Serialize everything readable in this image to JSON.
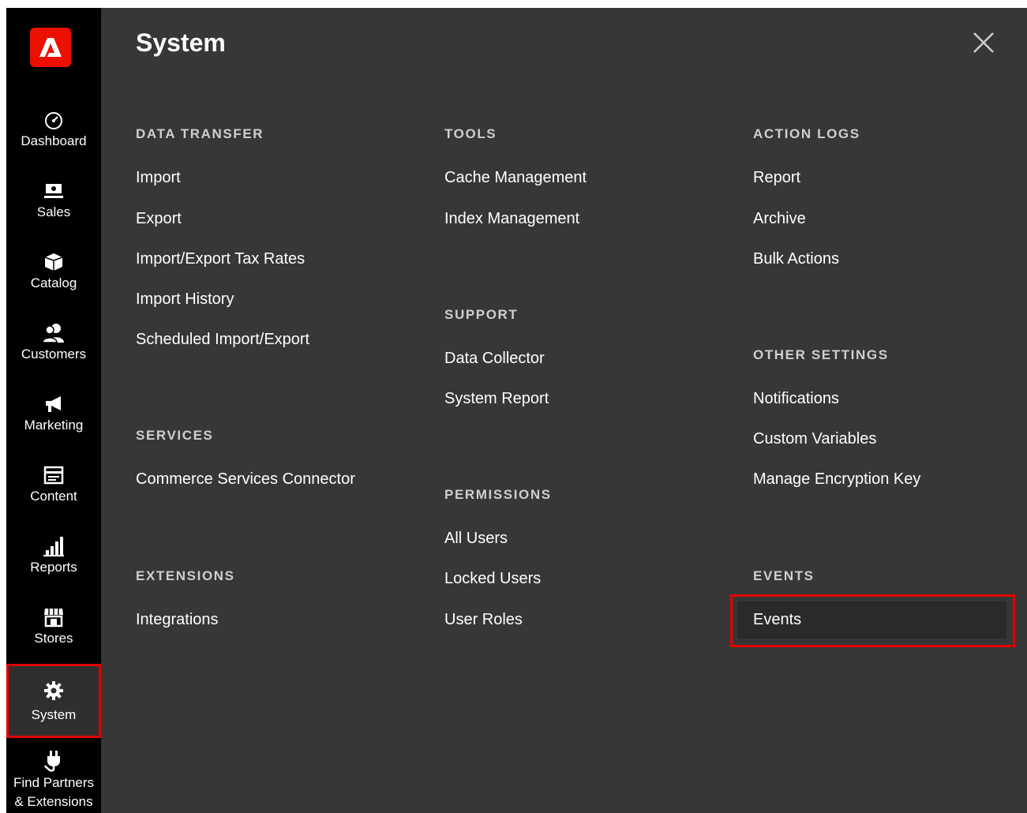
{
  "sidebar": {
    "logo": "adobe-logo",
    "items": [
      {
        "label": "Dashboard",
        "icon": "dashboard-icon"
      },
      {
        "label": "Sales",
        "icon": "sales-icon"
      },
      {
        "label": "Catalog",
        "icon": "catalog-icon"
      },
      {
        "label": "Customers",
        "icon": "customers-icon"
      },
      {
        "label": "Marketing",
        "icon": "marketing-icon"
      },
      {
        "label": "Content",
        "icon": "content-icon"
      },
      {
        "label": "Reports",
        "icon": "reports-icon"
      },
      {
        "label": "Stores",
        "icon": "stores-icon"
      },
      {
        "label": "System",
        "icon": "gear-icon"
      },
      {
        "label": "Find Partners",
        "label2": "& Extensions",
        "icon": "plug-icon"
      }
    ]
  },
  "panel": {
    "title": "System",
    "close_icon": "close-icon",
    "sections": {
      "data_transfer": {
        "heading": "DATA TRANSFER",
        "links": [
          "Import",
          "Export",
          "Import/Export Tax Rates",
          "Import History",
          "Scheduled Import/Export"
        ]
      },
      "services": {
        "heading": "SERVICES",
        "links": [
          "Commerce Services Connector"
        ]
      },
      "extensions": {
        "heading": "EXTENSIONS",
        "links": [
          "Integrations"
        ]
      },
      "tools": {
        "heading": "TOOLS",
        "links": [
          "Cache Management",
          "Index Management"
        ]
      },
      "support": {
        "heading": "SUPPORT",
        "links": [
          "Data Collector",
          "System Report"
        ]
      },
      "permissions": {
        "heading": "PERMISSIONS",
        "links": [
          "All Users",
          "Locked Users",
          "User Roles"
        ]
      },
      "action_logs": {
        "heading": "ACTION LOGS",
        "links": [
          "Report",
          "Archive",
          "Bulk Actions"
        ]
      },
      "other_settings": {
        "heading": "OTHER SETTINGS",
        "links": [
          "Notifications",
          "Custom Variables",
          "Manage Encryption Key"
        ]
      },
      "events": {
        "heading": "EVENTS",
        "links": [
          "Events"
        ]
      }
    }
  },
  "colors": {
    "sidebar_bg": "#000000",
    "panel_bg": "#373737",
    "highlight": "#e00000",
    "logo_bg": "#eb1000"
  }
}
